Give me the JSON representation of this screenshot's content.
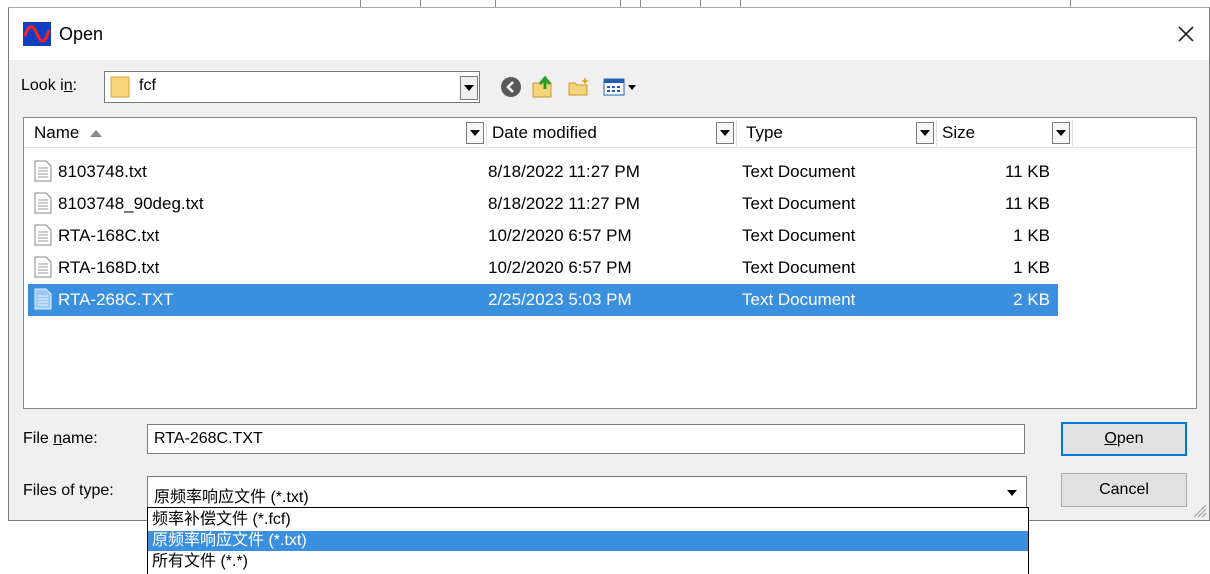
{
  "window": {
    "title": "Open"
  },
  "toolbar": {
    "lookin_label": "Look in:",
    "lookin_value": "fcf",
    "buttons": [
      "back-icon",
      "up-folder-icon",
      "new-folder-icon",
      "view-menu-icon"
    ]
  },
  "list": {
    "columns": [
      "Name",
      "Date modified",
      "Type",
      "Size"
    ],
    "rows": [
      {
        "name": "8103748.txt",
        "date": "8/18/2022 11:27 PM",
        "type": "Text Document",
        "size": "11 KB"
      },
      {
        "name": "8103748_90deg.txt",
        "date": "8/18/2022 11:27 PM",
        "type": "Text Document",
        "size": "11 KB"
      },
      {
        "name": "RTA-168C.txt",
        "date": "10/2/2020 6:57 PM",
        "type": "Text Document",
        "size": "1 KB"
      },
      {
        "name": "RTA-168D.txt",
        "date": "10/2/2020 6:57 PM",
        "type": "Text Document",
        "size": "1 KB"
      },
      {
        "name": "RTA-268C.TXT",
        "date": "2/25/2023 5:03 PM",
        "type": "Text Document",
        "size": "2 KB"
      }
    ],
    "selected_index": 4
  },
  "form": {
    "filename_label": "File name:",
    "filename_value": "RTA-268C.TXT",
    "filetype_label": "Files of type:",
    "filetype_value": "原频率响应文件 (*.txt)",
    "open_label": "Open",
    "cancel_label": "Cancel"
  },
  "filetype_options": [
    "频率补偿文件 (*.fcf)",
    "原频率响应文件 (*.txt)",
    "所有文件 (*.*)"
  ],
  "colors": {
    "selection": "#3a8fdf",
    "focus_border": "#0078d7"
  }
}
